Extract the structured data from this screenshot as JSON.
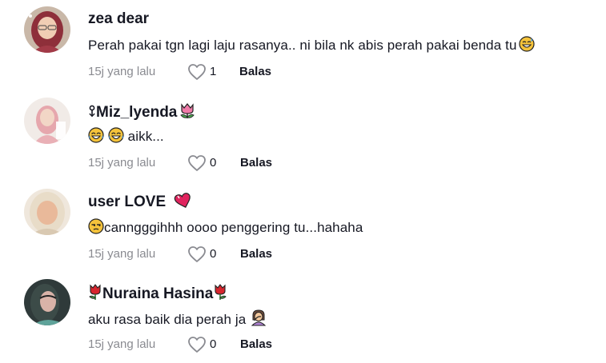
{
  "comments": [
    {
      "username": "zea dear",
      "text": "Perah pakai tgn lagi laju rasanya.. ni bila nk abis perah pakai benda tu",
      "time": "15j yang lalu",
      "likes": "1",
      "reply_label": "Balas"
    },
    {
      "username": "Miz_lyenda",
      "text": "aikk...",
      "time": "15j yang lalu",
      "likes": "0",
      "reply_label": "Balas"
    },
    {
      "username": "user LOVE",
      "text": "canngggihhh oooo penggering tu...hahaha",
      "time": "15j yang lalu",
      "likes": "0",
      "reply_label": "Balas"
    },
    {
      "username": "Nuraina Hasina",
      "text": "aku rasa baik dia perah ja",
      "time": "15j yang lalu",
      "likes": "0",
      "reply_label": "Balas"
    }
  ],
  "icons": {
    "like": "heart-outline-icon",
    "colors": {
      "meta_text": "#8a8b91",
      "text": "#161823",
      "heart_emoji": "#e0245e"
    }
  }
}
